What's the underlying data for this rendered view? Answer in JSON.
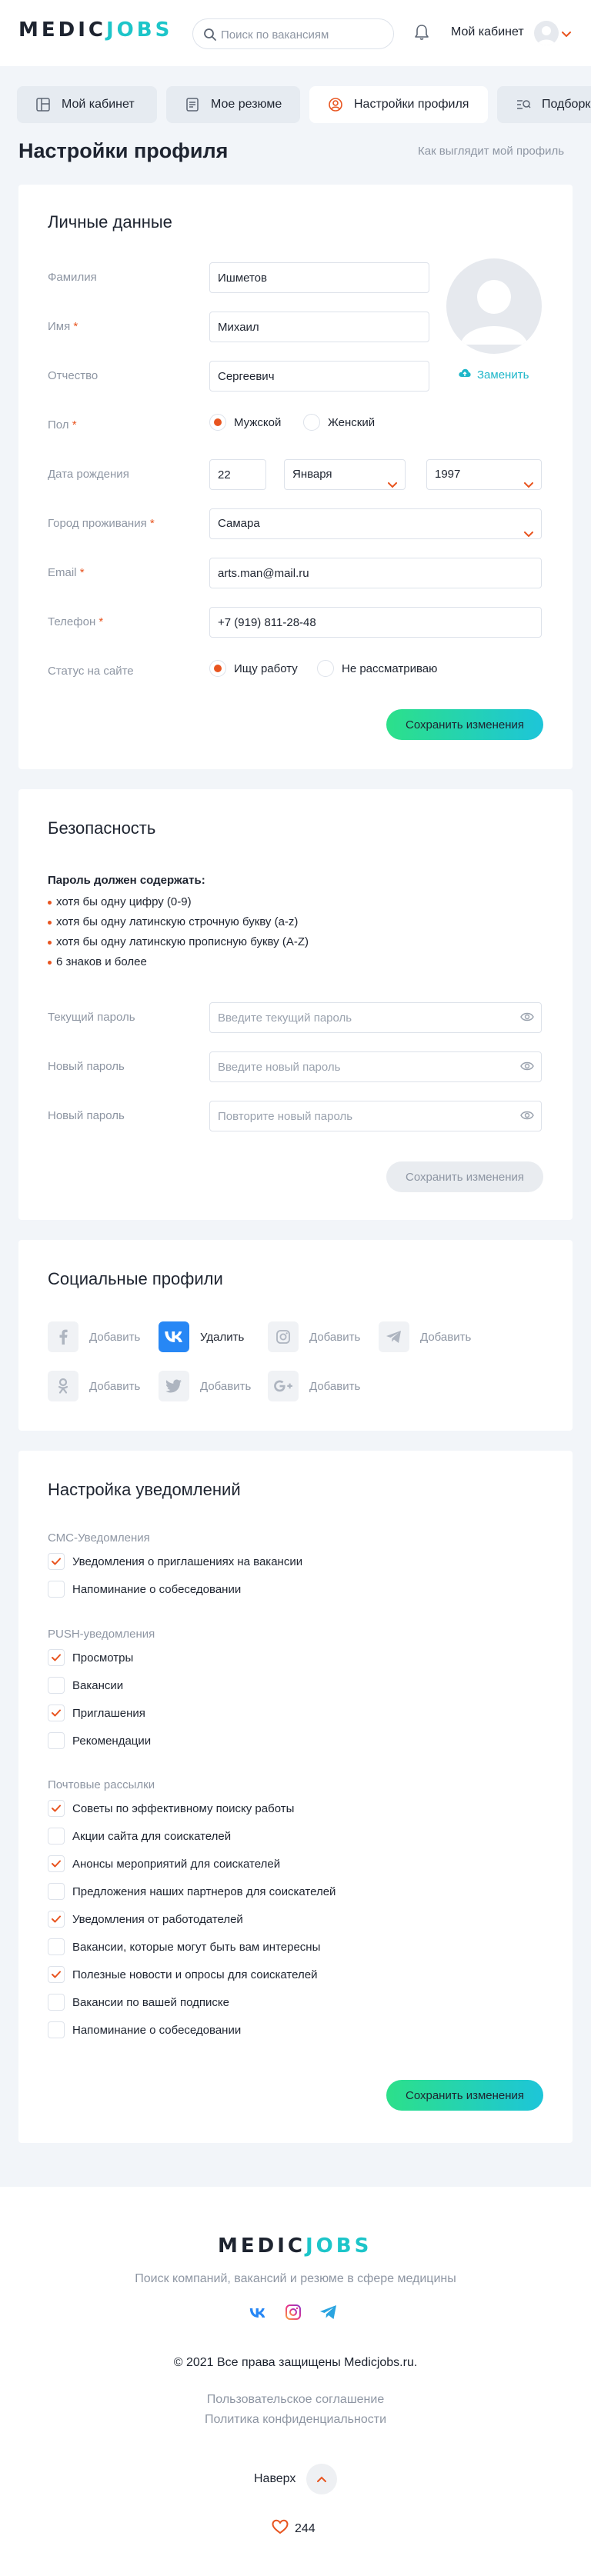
{
  "header": {
    "logo_part1": "MEDIC",
    "logo_part2": "JOBS",
    "search_placeholder": "Поиск по вакансиям",
    "cabinet_label": "Мой кабинет"
  },
  "tabs": [
    {
      "label": "Мой кабинет",
      "icon": "dashboard-icon",
      "active": false
    },
    {
      "label": "Мое резюме",
      "icon": "resume-icon",
      "active": false
    },
    {
      "label": "Настройки профиля",
      "icon": "user-circle-icon",
      "active": true
    },
    {
      "label": "Подборка",
      "icon": "search-list-icon",
      "active": false
    }
  ],
  "page": {
    "title": "Настройки профиля",
    "view_link": "Как выглядит мой профиль"
  },
  "personal": {
    "title": "Личные данные",
    "surname_label": "Фамилия",
    "surname_value": "Ишметов",
    "name_label": "Имя",
    "name_value": "Михаил",
    "patronymic_label": "Отчество",
    "patronymic_value": "Сергеевич",
    "gender_label": "Пол",
    "gender_male": "Мужской",
    "gender_female": "Женский",
    "gender_selected": "male",
    "birth_label": "Дата рождения",
    "birth_day": "22",
    "birth_month": "Января",
    "birth_year": "1997",
    "city_label": "Город проживания",
    "city_value": "Самара",
    "email_label": "Email",
    "email_value": "arts.man@mail.ru",
    "phone_label": "Телефон",
    "phone_value": "+7 (919) 811-28-48",
    "status_label": "Статус на сайте",
    "status_looking": "Ищу работу",
    "status_not": "Не рассматриваю",
    "status_selected": "looking",
    "change_photo": "Заменить",
    "required_mark": "*",
    "save": "Сохранить изменения"
  },
  "security": {
    "title": "Безопасность",
    "rules_title": "Пароль должен содержать:",
    "rules": [
      "хотя бы одну цифру (0-9)",
      "хотя бы одну латинскую строчную букву (a-z)",
      "хотя бы одну латинскую прописную букву (A-Z)",
      "6 знаков и более"
    ],
    "current_label": "Текущий пароль",
    "current_placeholder": "Введите текущий пароль",
    "new_label": "Новый пароль",
    "new_placeholder": "Введите новый пароль",
    "repeat_label": "Новый пароль",
    "repeat_placeholder": "Повторите новый пароль",
    "save": "Сохранить изменения"
  },
  "social": {
    "title": "Социальные профили",
    "items": [
      {
        "icon": "facebook-icon",
        "action": "Добавить",
        "connected": false
      },
      {
        "icon": "vk-icon",
        "action": "Удалить",
        "connected": true
      },
      {
        "icon": "instagram-icon",
        "action": "Добавить",
        "connected": false
      },
      {
        "icon": "telegram-icon",
        "action": "Добавить",
        "connected": false
      },
      {
        "icon": "odnoklassniki-icon",
        "action": "Добавить",
        "connected": false
      },
      {
        "icon": "twitter-icon",
        "action": "Добавить",
        "connected": false
      },
      {
        "icon": "google-plus-icon",
        "action": "Добавить",
        "connected": false
      }
    ]
  },
  "notifications": {
    "title": "Настройка уведомлений",
    "sms_title": "СМС-Уведомления",
    "sms": [
      {
        "label": "Уведомления о приглашениях на вакансии",
        "checked": true
      },
      {
        "label": "Напоминание о собеседовании",
        "checked": false
      }
    ],
    "push_title": "PUSH-уведомления",
    "push": [
      {
        "label": "Просмотры",
        "checked": true
      },
      {
        "label": "Вакансии",
        "checked": false
      },
      {
        "label": "Приглашения",
        "checked": true
      },
      {
        "label": "Рекомендации",
        "checked": false
      }
    ],
    "mail_title": "Почтовые рассылки",
    "mail": [
      {
        "label": "Советы по эффективному поиску работы",
        "checked": true
      },
      {
        "label": "Акции сайта для соискателей",
        "checked": false
      },
      {
        "label": "Анонсы мероприятий для соискателей",
        "checked": true
      },
      {
        "label": "Предложения наших партнеров для соискателей",
        "checked": false
      },
      {
        "label": "Уведомления от работодателей",
        "checked": true
      },
      {
        "label": "Вакансии, которые могут быть вам интересны",
        "checked": false
      },
      {
        "label": "Полезные новости и опросы для соискателей",
        "checked": true
      },
      {
        "label": "Вакансии по вашей подписке",
        "checked": false
      },
      {
        "label": "Напоминание о собеседовании",
        "checked": false
      }
    ],
    "save": "Сохранить изменения"
  },
  "footer": {
    "logo_part1": "MEDIC",
    "logo_part2": "JOBS",
    "description": "Поиск компаний, вакансий и резюме в сфере медицины",
    "copyright": "© 2021 Все права защищены Medicjobs.ru.",
    "agreement": "Пользовательское соглашение",
    "privacy": "Политика конфиденциальности",
    "up_label": "Наверх",
    "likes": "244"
  },
  "colors": {
    "accent_orange": "#E8541F",
    "accent_teal": "#1DC5C9",
    "gradient_start": "#2CE08A",
    "gradient_end": "#1DC5D9",
    "vk_blue": "#2787F5",
    "background": "#F2F5F9"
  }
}
